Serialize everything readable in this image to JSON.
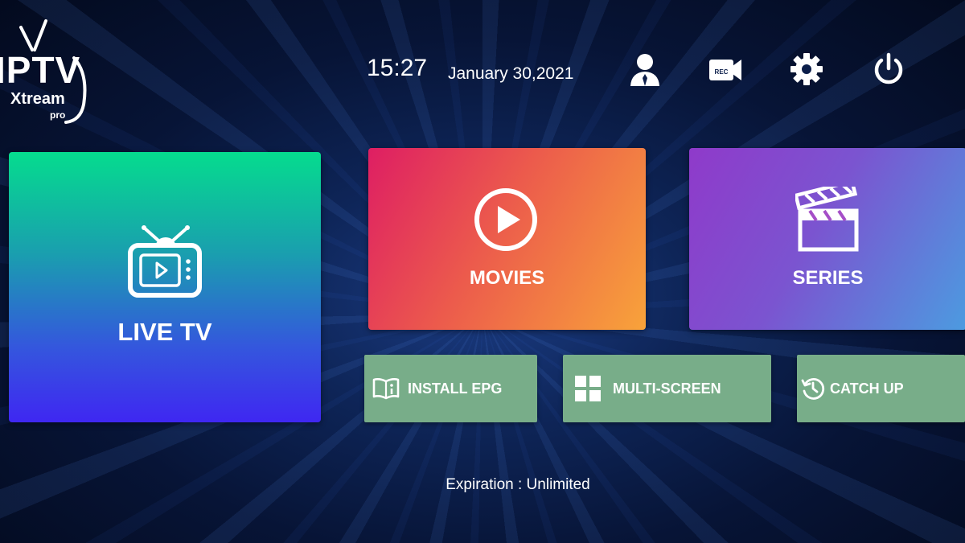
{
  "logo": {
    "main": "IPTV",
    "sub": "Xtream",
    "tag": "pro"
  },
  "header": {
    "time": "15:27",
    "date": "January 30,2021",
    "icons": [
      "user-icon",
      "rec-camera-icon",
      "gear-icon",
      "power-icon"
    ],
    "rec_label": "REC"
  },
  "tiles": {
    "live": {
      "label": "LIVE TV",
      "icon": "tv-icon"
    },
    "movies": {
      "label": "MOVIES",
      "icon": "play-circle-icon"
    },
    "series": {
      "label": "SERIES",
      "icon": "clapperboard-icon"
    }
  },
  "actions": {
    "epg": {
      "label": "INSTALL EPG",
      "icon": "book-icon"
    },
    "multi": {
      "label": "MULTI-SCREEN",
      "icon": "grid-icon"
    },
    "catch": {
      "label": "CATCH UP",
      "icon": "history-icon"
    }
  },
  "footer": {
    "expiration": "Expiration : Unlimited"
  },
  "colors": {
    "live_top": "#05dc8e",
    "live_bottom": "#3f27f2",
    "movies_start": "#de1e63",
    "movies_end": "#f8a33a",
    "series_start": "#8f3aca",
    "series_end": "#4c9be0",
    "action_button": "#78ad89"
  }
}
